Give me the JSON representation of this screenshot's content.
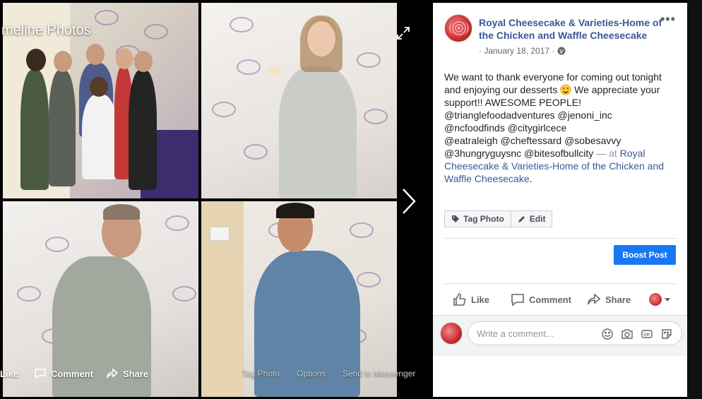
{
  "viewer": {
    "title": "meline Photos",
    "actions": {
      "like": "Like",
      "comment": "Comment",
      "share": "Share",
      "tag_photo": "Tag Photo",
      "options": "Options",
      "send": "Send in Messenger"
    }
  },
  "post": {
    "page_name": "Royal Cheesecake & Varieties-Home of the Chicken and Waffle Cheesecake",
    "date": "· January 18, 2017 ·",
    "text_1": "We want to thank everyone for coming out tonight and enjoying our desserts ",
    "text_2": " We appreciate your support!! AWESOME PEOPLE!",
    "text_3": "@trianglefoodadventures @jenoni_inc @ncfoodfinds @citygirlcece",
    "text_4": "@eatraleigh @cheftessard @sobesavvy",
    "text_5": "@3hungryguysnc @bitesofbullcity",
    "at": " — at ",
    "location": "Royal Cheesecake & Varieties-Home of the Chicken and Waffle Cheesecake",
    "period": "."
  },
  "buttons": {
    "tag_photo": "Tag Photo",
    "edit": "Edit",
    "boost": "Boost Post",
    "like": "Like",
    "comment": "Comment",
    "share": "Share"
  },
  "comment_box": {
    "placeholder": "Write a comment..."
  }
}
